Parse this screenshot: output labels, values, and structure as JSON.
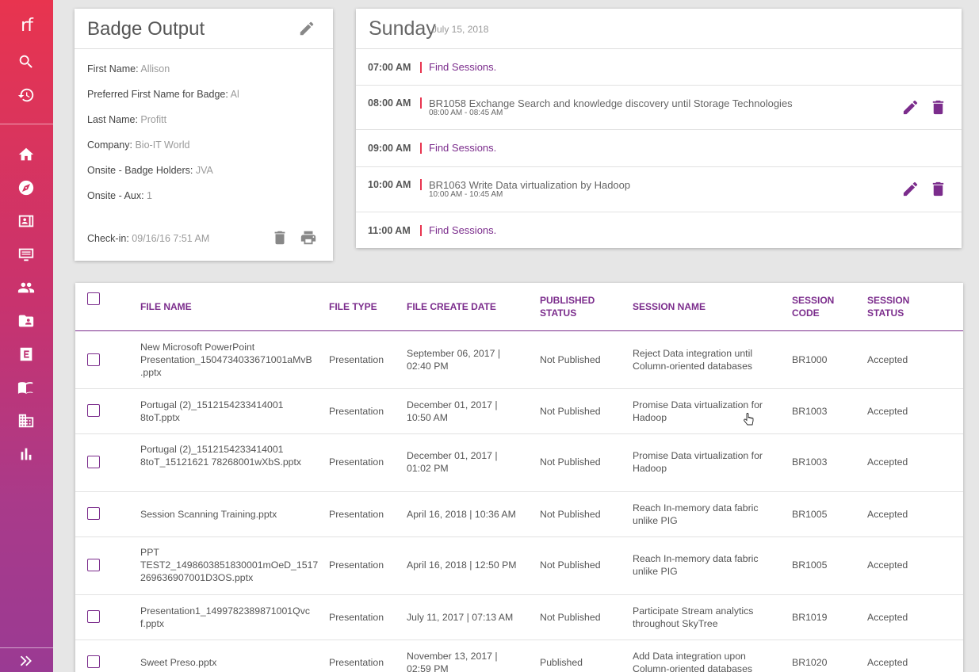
{
  "sidebar": {
    "logo": "rf",
    "top_icons": [
      "search-icon",
      "history-icon"
    ],
    "nav_icons": [
      "home-icon",
      "compass-icon",
      "badge-icon",
      "presentation-icon",
      "people-icon",
      "folder-account-icon",
      "exhibitor-icon",
      "book-icon",
      "building-icon",
      "bar-chart-icon"
    ],
    "expand_icon": "double-chevron-right-icon",
    "gradient": [
      "#e8344f",
      "#9a3a93"
    ]
  },
  "badge": {
    "title": "Badge Output",
    "fields": [
      {
        "label": "First Name:",
        "value": "Allison"
      },
      {
        "label": "Preferred First Name for Badge:",
        "value": "Al"
      },
      {
        "label": "Last Name:",
        "value": "Profitt"
      },
      {
        "label": "Company:",
        "value": "Bio-IT World"
      },
      {
        "label": "Onsite - Badge Holders:",
        "value": "JVA"
      },
      {
        "label": "Onsite - Aux:",
        "value": "1"
      }
    ],
    "checkin_label": "Check-in:",
    "checkin_value": "09/16/16 7:51 AM"
  },
  "schedule": {
    "day": "Sunday",
    "date": "July 15, 2018",
    "rows": [
      {
        "time": "07:00 AM",
        "link": "Find Sessions."
      },
      {
        "time": "08:00 AM",
        "title": "BR1058 Exchange Search and knowledge discovery until Storage Technologies",
        "range": "08:00 AM - 08:45 AM"
      },
      {
        "time": "09:00 AM",
        "link": "Find Sessions."
      },
      {
        "time": "10:00 AM",
        "title": "BR1063 Write Data virtualization by Hadoop",
        "range": "10:00 AM - 10:45 AM"
      },
      {
        "time": "11:00 AM",
        "link": "Find Sessions."
      }
    ]
  },
  "table": {
    "columns": [
      "FILE NAME",
      "FILE TYPE",
      "FILE CREATE DATE",
      "PUBLISHED STATUS",
      "SESSION NAME",
      "SESSION CODE",
      "SESSION STATUS"
    ],
    "rows": [
      {
        "file": "New Microsoft PowerPoint Presentation_1504734033671001aMvB .pptx",
        "type": "Presentation",
        "date": "September 06, 2017 | 02:40 PM",
        "pub": "Not Published",
        "session": "Reject Data integration until Column-oriented databases",
        "code": "BR1000",
        "status": "Accepted"
      },
      {
        "file": "Portugal (2)_1512154233414001 8toT.pptx",
        "type": "Presentation",
        "date": "December 01, 2017 | 10:50 AM",
        "pub": "Not Published",
        "session": "Promise Data virtualization for Hadoop",
        "code": "BR1003",
        "status": "Accepted"
      },
      {
        "file": "Portugal (2)_1512154233414001 8toT_15121621 78268001wXbS.pptx",
        "type": "Presentation",
        "date": "December 01, 2017 | 01:02 PM",
        "pub": "Not Published",
        "session": "Promise Data virtualization for Hadoop",
        "code": "BR1003",
        "status": "Accepted"
      },
      {
        "file": "Session Scanning Training.pptx",
        "type": "Presentation",
        "date": "April 16, 2018 | 10:36 AM",
        "pub": "Not Published",
        "session": "Reach In-memory data fabric unlike PIG",
        "code": "BR1005",
        "status": "Accepted"
      },
      {
        "file": "PPT TEST2_1498603851830001mOeD_1517 269636907001D3OS.pptx",
        "type": "Presentation",
        "date": "April 16, 2018 | 12:50 PM",
        "pub": "Not Published",
        "session": "Reach In-memory data fabric unlike PIG",
        "code": "BR1005",
        "status": "Accepted"
      },
      {
        "file": "Presentation1_1499782389871001Qvc f.pptx",
        "type": "Presentation",
        "date": "July 11, 2017 | 07:13 AM",
        "pub": "Not Published",
        "session": "Participate Stream analytics throughout SkyTree",
        "code": "BR1019",
        "status": "Accepted"
      },
      {
        "file": "Sweet Preso.pptx",
        "type": "Presentation",
        "date": "November 13, 2017 | 02:59 PM",
        "pub": "Published",
        "session": "Add Data integration upon Column-oriented databases",
        "code": "BR1020",
        "status": "Accepted"
      }
    ]
  },
  "colors": {
    "accent": "#7b2c8c",
    "marker": "#e8344f"
  }
}
